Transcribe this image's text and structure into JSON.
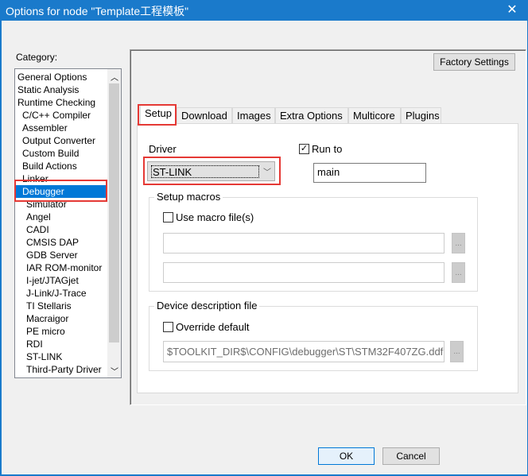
{
  "window": {
    "title": "Options for node \"Template工程模板\"",
    "close": "✕"
  },
  "category": {
    "label": "Category:",
    "items": [
      {
        "label": "General Options",
        "level": 0
      },
      {
        "label": "Static Analysis",
        "level": 0
      },
      {
        "label": "Runtime Checking",
        "level": 0
      },
      {
        "label": "C/C++ Compiler",
        "level": 1
      },
      {
        "label": "Assembler",
        "level": 1
      },
      {
        "label": "Output Converter",
        "level": 1
      },
      {
        "label": "Custom Build",
        "level": 1
      },
      {
        "label": "Build Actions",
        "level": 1
      },
      {
        "label": "Linker",
        "level": 1
      },
      {
        "label": "Debugger",
        "level": 1,
        "selected": true
      },
      {
        "label": "Simulator",
        "level": 2
      },
      {
        "label": "Angel",
        "level": 2
      },
      {
        "label": "CADI",
        "level": 2
      },
      {
        "label": "CMSIS DAP",
        "level": 2
      },
      {
        "label": "GDB Server",
        "level": 2
      },
      {
        "label": "IAR ROM-monitor",
        "level": 2
      },
      {
        "label": "I-jet/JTAGjet",
        "level": 2
      },
      {
        "label": "J-Link/J-Trace",
        "level": 2
      },
      {
        "label": "TI Stellaris",
        "level": 2
      },
      {
        "label": "Macraigor",
        "level": 2
      },
      {
        "label": "PE micro",
        "level": 2
      },
      {
        "label": "RDI",
        "level": 2
      },
      {
        "label": "ST-LINK",
        "level": 2
      },
      {
        "label": "Third-Party Driver",
        "level": 2
      }
    ]
  },
  "factory_settings": "Factory Settings",
  "tabs": [
    "Setup",
    "Download",
    "Images",
    "Extra Options",
    "Multicore",
    "Plugins"
  ],
  "setup": {
    "driver_label": "Driver",
    "driver_value": "ST-LINK",
    "run_to_label": "Run to",
    "run_to_checked": true,
    "run_to_value": "main",
    "macros_legend": "Setup macros",
    "use_macro_label": "Use macro file(s)",
    "macro1": "",
    "macro2": "",
    "device_legend": "Device description file",
    "override_label": "Override default",
    "device_path": "$TOOLKIT_DIR$\\CONFIG\\debugger\\ST\\STM32F407ZG.ddf",
    "browse": "..."
  },
  "buttons": {
    "ok": "OK",
    "cancel": "Cancel"
  }
}
